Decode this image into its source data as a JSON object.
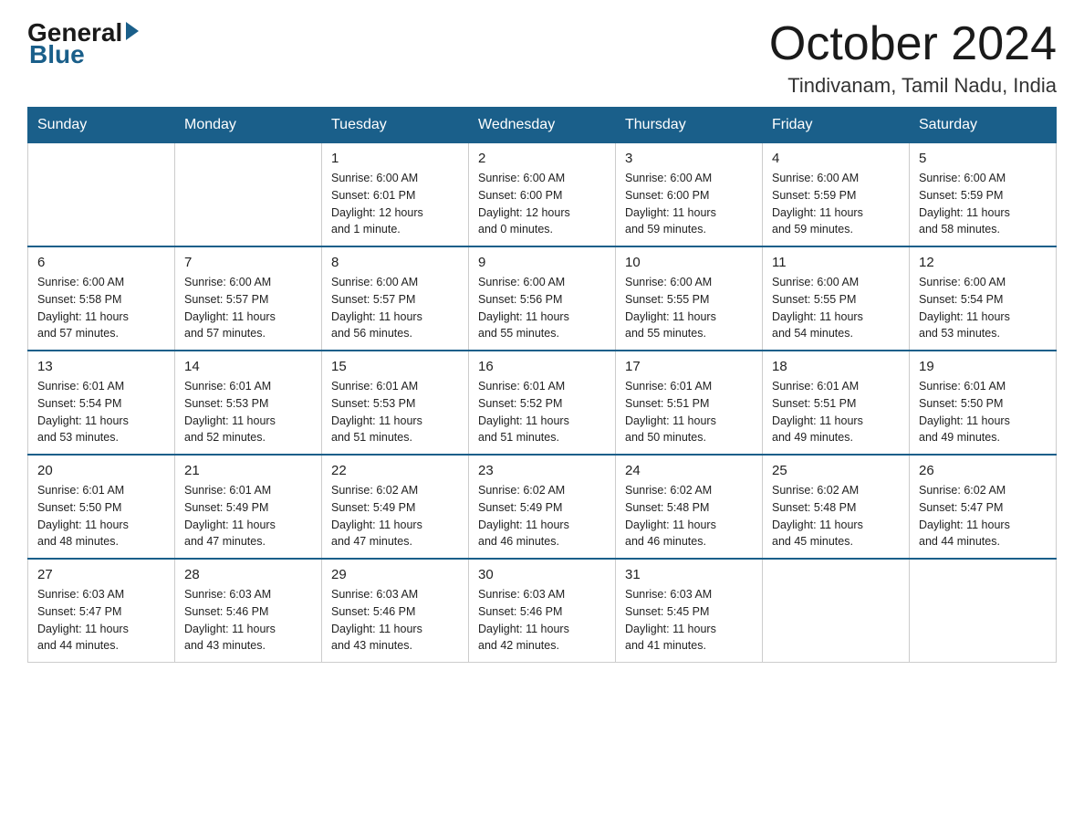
{
  "header": {
    "logo_general": "General",
    "logo_blue": "Blue",
    "month_year": "October 2024",
    "location": "Tindivanam, Tamil Nadu, India"
  },
  "weekdays": [
    "Sunday",
    "Monday",
    "Tuesday",
    "Wednesday",
    "Thursday",
    "Friday",
    "Saturday"
  ],
  "weeks": [
    [
      {
        "day": "",
        "info": ""
      },
      {
        "day": "",
        "info": ""
      },
      {
        "day": "1",
        "info": "Sunrise: 6:00 AM\nSunset: 6:01 PM\nDaylight: 12 hours\nand 1 minute."
      },
      {
        "day": "2",
        "info": "Sunrise: 6:00 AM\nSunset: 6:00 PM\nDaylight: 12 hours\nand 0 minutes."
      },
      {
        "day": "3",
        "info": "Sunrise: 6:00 AM\nSunset: 6:00 PM\nDaylight: 11 hours\nand 59 minutes."
      },
      {
        "day": "4",
        "info": "Sunrise: 6:00 AM\nSunset: 5:59 PM\nDaylight: 11 hours\nand 59 minutes."
      },
      {
        "day": "5",
        "info": "Sunrise: 6:00 AM\nSunset: 5:59 PM\nDaylight: 11 hours\nand 58 minutes."
      }
    ],
    [
      {
        "day": "6",
        "info": "Sunrise: 6:00 AM\nSunset: 5:58 PM\nDaylight: 11 hours\nand 57 minutes."
      },
      {
        "day": "7",
        "info": "Sunrise: 6:00 AM\nSunset: 5:57 PM\nDaylight: 11 hours\nand 57 minutes."
      },
      {
        "day": "8",
        "info": "Sunrise: 6:00 AM\nSunset: 5:57 PM\nDaylight: 11 hours\nand 56 minutes."
      },
      {
        "day": "9",
        "info": "Sunrise: 6:00 AM\nSunset: 5:56 PM\nDaylight: 11 hours\nand 55 minutes."
      },
      {
        "day": "10",
        "info": "Sunrise: 6:00 AM\nSunset: 5:55 PM\nDaylight: 11 hours\nand 55 minutes."
      },
      {
        "day": "11",
        "info": "Sunrise: 6:00 AM\nSunset: 5:55 PM\nDaylight: 11 hours\nand 54 minutes."
      },
      {
        "day": "12",
        "info": "Sunrise: 6:00 AM\nSunset: 5:54 PM\nDaylight: 11 hours\nand 53 minutes."
      }
    ],
    [
      {
        "day": "13",
        "info": "Sunrise: 6:01 AM\nSunset: 5:54 PM\nDaylight: 11 hours\nand 53 minutes."
      },
      {
        "day": "14",
        "info": "Sunrise: 6:01 AM\nSunset: 5:53 PM\nDaylight: 11 hours\nand 52 minutes."
      },
      {
        "day": "15",
        "info": "Sunrise: 6:01 AM\nSunset: 5:53 PM\nDaylight: 11 hours\nand 51 minutes."
      },
      {
        "day": "16",
        "info": "Sunrise: 6:01 AM\nSunset: 5:52 PM\nDaylight: 11 hours\nand 51 minutes."
      },
      {
        "day": "17",
        "info": "Sunrise: 6:01 AM\nSunset: 5:51 PM\nDaylight: 11 hours\nand 50 minutes."
      },
      {
        "day": "18",
        "info": "Sunrise: 6:01 AM\nSunset: 5:51 PM\nDaylight: 11 hours\nand 49 minutes."
      },
      {
        "day": "19",
        "info": "Sunrise: 6:01 AM\nSunset: 5:50 PM\nDaylight: 11 hours\nand 49 minutes."
      }
    ],
    [
      {
        "day": "20",
        "info": "Sunrise: 6:01 AM\nSunset: 5:50 PM\nDaylight: 11 hours\nand 48 minutes."
      },
      {
        "day": "21",
        "info": "Sunrise: 6:01 AM\nSunset: 5:49 PM\nDaylight: 11 hours\nand 47 minutes."
      },
      {
        "day": "22",
        "info": "Sunrise: 6:02 AM\nSunset: 5:49 PM\nDaylight: 11 hours\nand 47 minutes."
      },
      {
        "day": "23",
        "info": "Sunrise: 6:02 AM\nSunset: 5:49 PM\nDaylight: 11 hours\nand 46 minutes."
      },
      {
        "day": "24",
        "info": "Sunrise: 6:02 AM\nSunset: 5:48 PM\nDaylight: 11 hours\nand 46 minutes."
      },
      {
        "day": "25",
        "info": "Sunrise: 6:02 AM\nSunset: 5:48 PM\nDaylight: 11 hours\nand 45 minutes."
      },
      {
        "day": "26",
        "info": "Sunrise: 6:02 AM\nSunset: 5:47 PM\nDaylight: 11 hours\nand 44 minutes."
      }
    ],
    [
      {
        "day": "27",
        "info": "Sunrise: 6:03 AM\nSunset: 5:47 PM\nDaylight: 11 hours\nand 44 minutes."
      },
      {
        "day": "28",
        "info": "Sunrise: 6:03 AM\nSunset: 5:46 PM\nDaylight: 11 hours\nand 43 minutes."
      },
      {
        "day": "29",
        "info": "Sunrise: 6:03 AM\nSunset: 5:46 PM\nDaylight: 11 hours\nand 43 minutes."
      },
      {
        "day": "30",
        "info": "Sunrise: 6:03 AM\nSunset: 5:46 PM\nDaylight: 11 hours\nand 42 minutes."
      },
      {
        "day": "31",
        "info": "Sunrise: 6:03 AM\nSunset: 5:45 PM\nDaylight: 11 hours\nand 41 minutes."
      },
      {
        "day": "",
        "info": ""
      },
      {
        "day": "",
        "info": ""
      }
    ]
  ]
}
